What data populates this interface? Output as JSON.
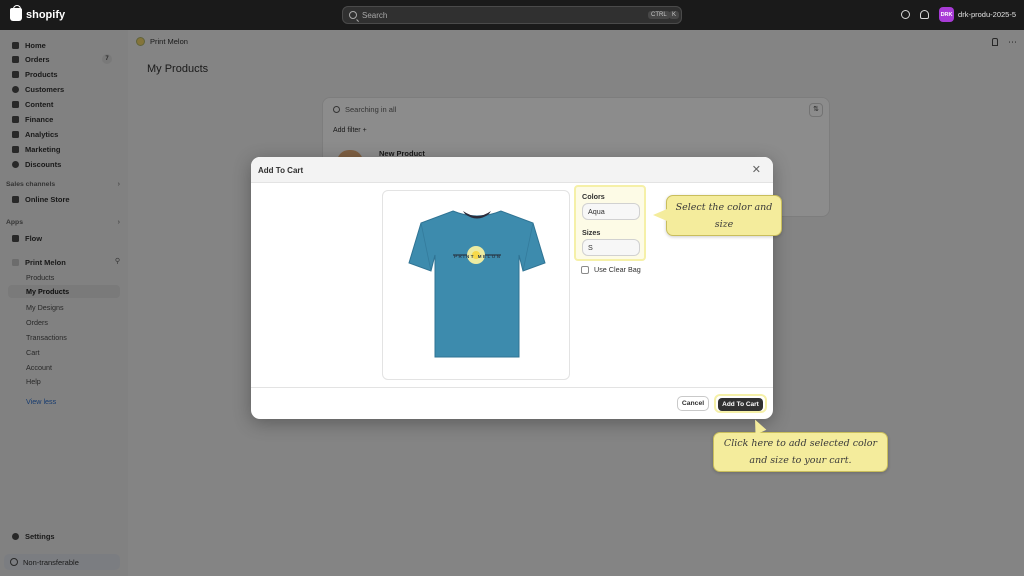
{
  "topbar": {
    "brand": "shopify",
    "search_placeholder": "Search",
    "kbd_1": "CTRL",
    "kbd_2": "K",
    "store_avatar": "DRK",
    "store_name": "drk-produ-2025-5"
  },
  "sidebar": {
    "items": [
      {
        "label": "Home"
      },
      {
        "label": "Orders",
        "badge": "7"
      },
      {
        "label": "Products"
      },
      {
        "label": "Customers"
      },
      {
        "label": "Content"
      },
      {
        "label": "Finance"
      },
      {
        "label": "Analytics"
      },
      {
        "label": "Marketing"
      },
      {
        "label": "Discounts"
      }
    ],
    "sales_channels_label": "Sales channels",
    "online_store": "Online Store",
    "apps_label": "Apps",
    "flow": "Flow",
    "app_name": "Print Melon",
    "app_subitems": [
      "Products",
      "My Products",
      "My Designs",
      "Orders",
      "Transactions",
      "Cart",
      "Account",
      "Help"
    ],
    "view_less": "View less",
    "settings": "Settings",
    "non_transferable": "Non-transferable"
  },
  "main": {
    "breadcrumb": "Print Melon",
    "page_title": "My Products",
    "card": {
      "search_placeholder": "Searching in all",
      "add_filter": "Add filter +",
      "product_name": "New Product"
    }
  },
  "modal": {
    "title": "Add To Cart",
    "shirt_print": "PRINT MELON",
    "colors_label": "Colors",
    "color_value": "Aqua",
    "sizes_label": "Sizes",
    "size_value": "S",
    "clear_bag_label": "Use Clear Bag",
    "cancel_label": "Cancel",
    "add_label": "Add To Cart"
  },
  "callouts": {
    "select": "Select the color and size",
    "add": "Click here to add selected color and size to your cart."
  },
  "colors": {
    "shirt": "#3d8bad",
    "highlight": "#f4ec9c"
  }
}
